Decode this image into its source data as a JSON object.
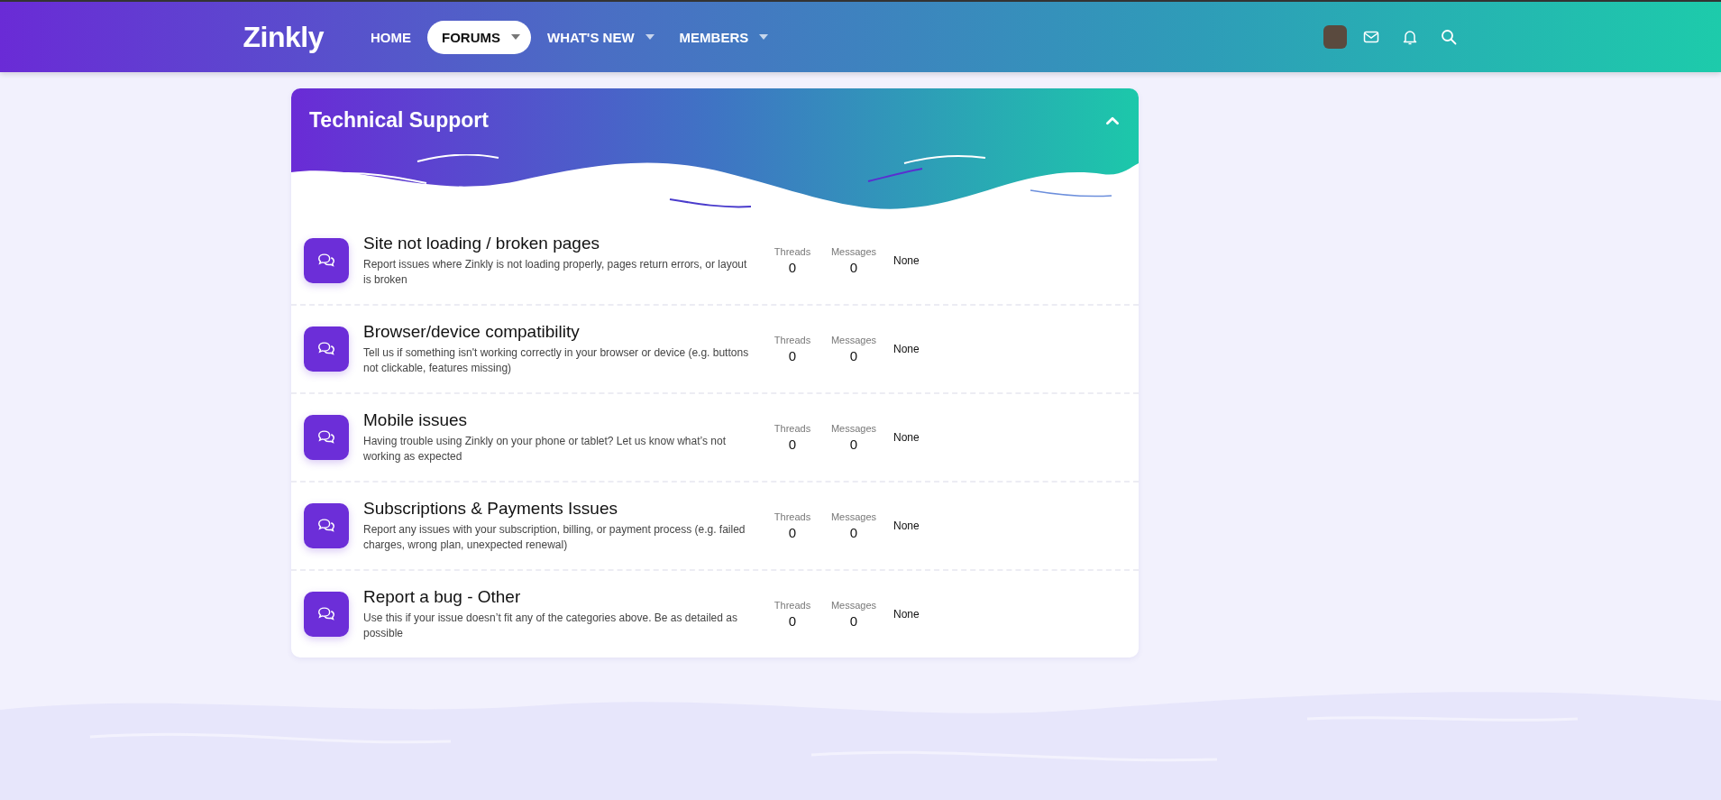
{
  "header": {
    "logo": "Zinkly",
    "nav": [
      {
        "label": "HOME",
        "selected": false,
        "dropdown": false
      },
      {
        "label": "FORUMS",
        "selected": true,
        "dropdown": true
      },
      {
        "label": "WHAT'S NEW",
        "selected": false,
        "dropdown": true
      },
      {
        "label": "MEMBERS",
        "selected": false,
        "dropdown": true
      }
    ]
  },
  "category": {
    "title": "Technical Support",
    "expanded": true,
    "forums": [
      {
        "title": "Site not loading / broken pages",
        "description": "Report issues where Zinkly is not loading properly, pages return errors, or layout is broken",
        "threads_label": "Threads",
        "threads": "0",
        "messages_label": "Messages",
        "messages": "0",
        "latest": "None"
      },
      {
        "title": "Browser/device compatibility",
        "description": "Tell us if something isn't working correctly in your browser or device (e.g. buttons not clickable, features missing)",
        "threads_label": "Threads",
        "threads": "0",
        "messages_label": "Messages",
        "messages": "0",
        "latest": "None"
      },
      {
        "title": "Mobile issues",
        "description": "Having trouble using Zinkly on your phone or tablet? Let us know what’s not working as expected",
        "threads_label": "Threads",
        "threads": "0",
        "messages_label": "Messages",
        "messages": "0",
        "latest": "None"
      },
      {
        "title": "Subscriptions & Payments Issues",
        "description": "Report any issues with your subscription, billing, or payment process (e.g. failed charges, wrong plan, unexpected renewal)",
        "threads_label": "Threads",
        "threads": "0",
        "messages_label": "Messages",
        "messages": "0",
        "latest": "None"
      },
      {
        "title": "Report a bug - Other",
        "description": "Use this if your issue doesn’t fit any of the categories above. Be as detailed as possible",
        "threads_label": "Threads",
        "threads": "0",
        "messages_label": "Messages",
        "messages": "0",
        "latest": "None"
      }
    ]
  }
}
